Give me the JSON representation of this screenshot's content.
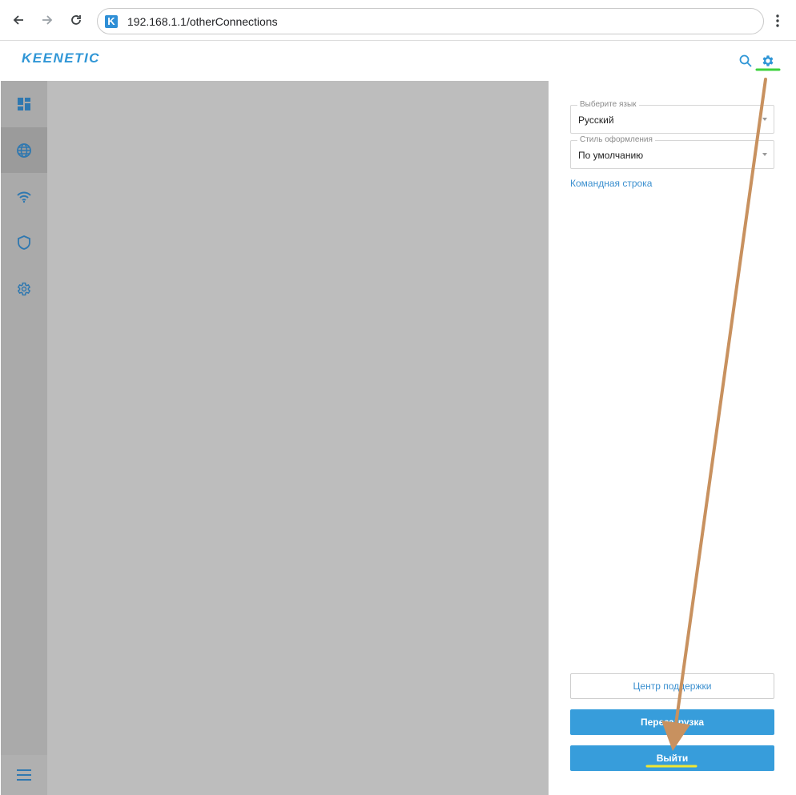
{
  "browser": {
    "url": "192.168.1.1/otherConnections",
    "favicon_letter": "K"
  },
  "header": {
    "logo": "KEENETIC"
  },
  "icons": {
    "search": "search-icon",
    "settings": "gear-icon",
    "dashboard": "dashboard-icon",
    "internet": "globe-icon",
    "wifi": "wifi-icon",
    "security": "shield-icon",
    "management": "cog-icon",
    "menu": "hamburger-icon"
  },
  "colors": {
    "accent": "#379ddb",
    "annotation_arrow": "#c8915f",
    "highlight_green": "#3ed13e",
    "highlight_yellow": "#f0e632"
  },
  "settings_panel": {
    "language": {
      "label": "Выберите язык",
      "value": "Русский"
    },
    "theme": {
      "label": "Стиль оформления",
      "value": "По умолчанию"
    },
    "command_line_link": "Командная строка",
    "support_button": "Центр поддержки",
    "reboot_button": "Перезагрузка",
    "logout_button": "Выйти"
  }
}
